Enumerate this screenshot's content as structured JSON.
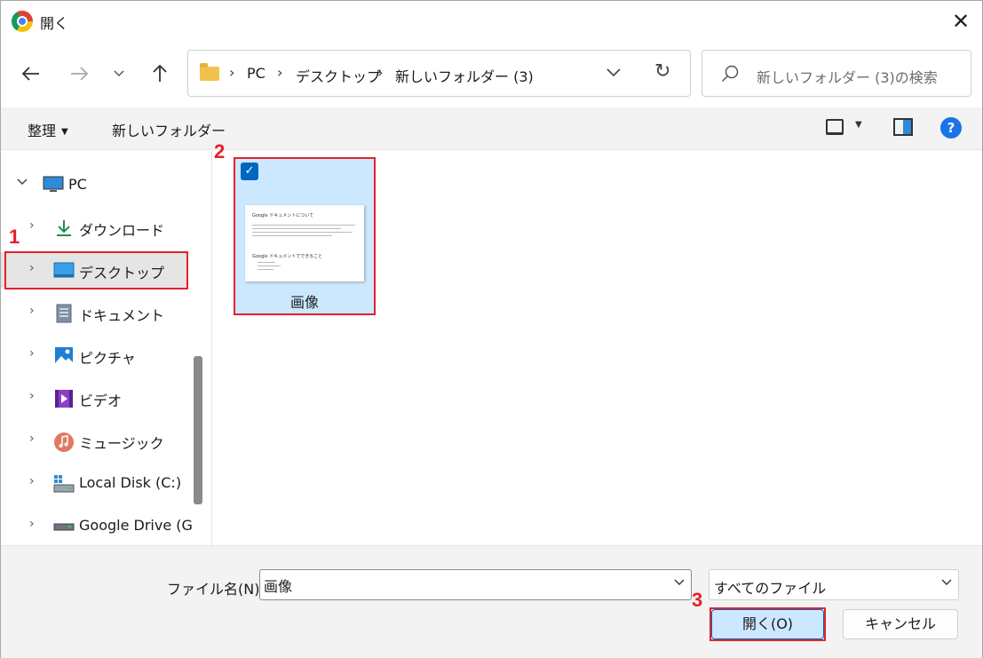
{
  "window": {
    "title": "開く",
    "close_glyph": "✕"
  },
  "nav": {
    "back_glyph": "←",
    "forward_glyph": "→",
    "recent_glyph": "⌄",
    "up_glyph": "↑",
    "breadcrumb": [
      "PC",
      "デスクトップ",
      "新しいフォルダー (3)"
    ],
    "breadcrumb_sep": "›",
    "address_dropdown_glyph": "⌄",
    "refresh_glyph": "↻",
    "search_placeholder": "新しいフォルダー (3)の検索"
  },
  "toolbar": {
    "organize_label": "整理",
    "organize_caret": "▼",
    "new_folder_label": "新しいフォルダー",
    "view_caret": "▼",
    "help_glyph": "?"
  },
  "sidebar": {
    "items": [
      {
        "label": "PC",
        "icon": "pc-icon",
        "chevron": "⌄"
      },
      {
        "label": "ダウンロード",
        "icon": "download-icon",
        "chevron": "›"
      },
      {
        "label": "デスクトップ",
        "icon": "desktop-icon",
        "chevron": "›",
        "selected": true
      },
      {
        "label": "ドキュメント",
        "icon": "document-icon",
        "chevron": "›"
      },
      {
        "label": "ピクチャ",
        "icon": "pictures-icon",
        "chevron": "›"
      },
      {
        "label": "ビデオ",
        "icon": "video-icon",
        "chevron": "›"
      },
      {
        "label": "ミュージック",
        "icon": "music-icon",
        "chevron": "›"
      },
      {
        "label": "Local Disk (C:)",
        "icon": "local-disk-icon",
        "chevron": "›"
      },
      {
        "label": "Google Drive (G",
        "icon": "google-drive-icon",
        "chevron": "›"
      }
    ]
  },
  "files": {
    "items": [
      {
        "name": "画像",
        "selected": true,
        "check_glyph": "✓",
        "thumbnail": {
          "heading1": "Google ドキュメントについて",
          "heading2": "Google ドキュメントでできること"
        }
      }
    ]
  },
  "annotations": {
    "step1": "1",
    "step2": "2",
    "step3": "3",
    "color": "#e52129"
  },
  "bottom": {
    "filename_label": "ファイル名(N):",
    "filename_value": "画像",
    "filename_dropdown_glyph": "⌄",
    "filetype_value": "すべてのファイル",
    "filetype_dropdown_glyph": "⌄",
    "open_button": "開く(O)",
    "cancel_button": "キャンセル"
  },
  "colors": {
    "accent": "#0067c0",
    "selection": "#cce8ff",
    "toolbar_bg": "#f3f3f3"
  }
}
